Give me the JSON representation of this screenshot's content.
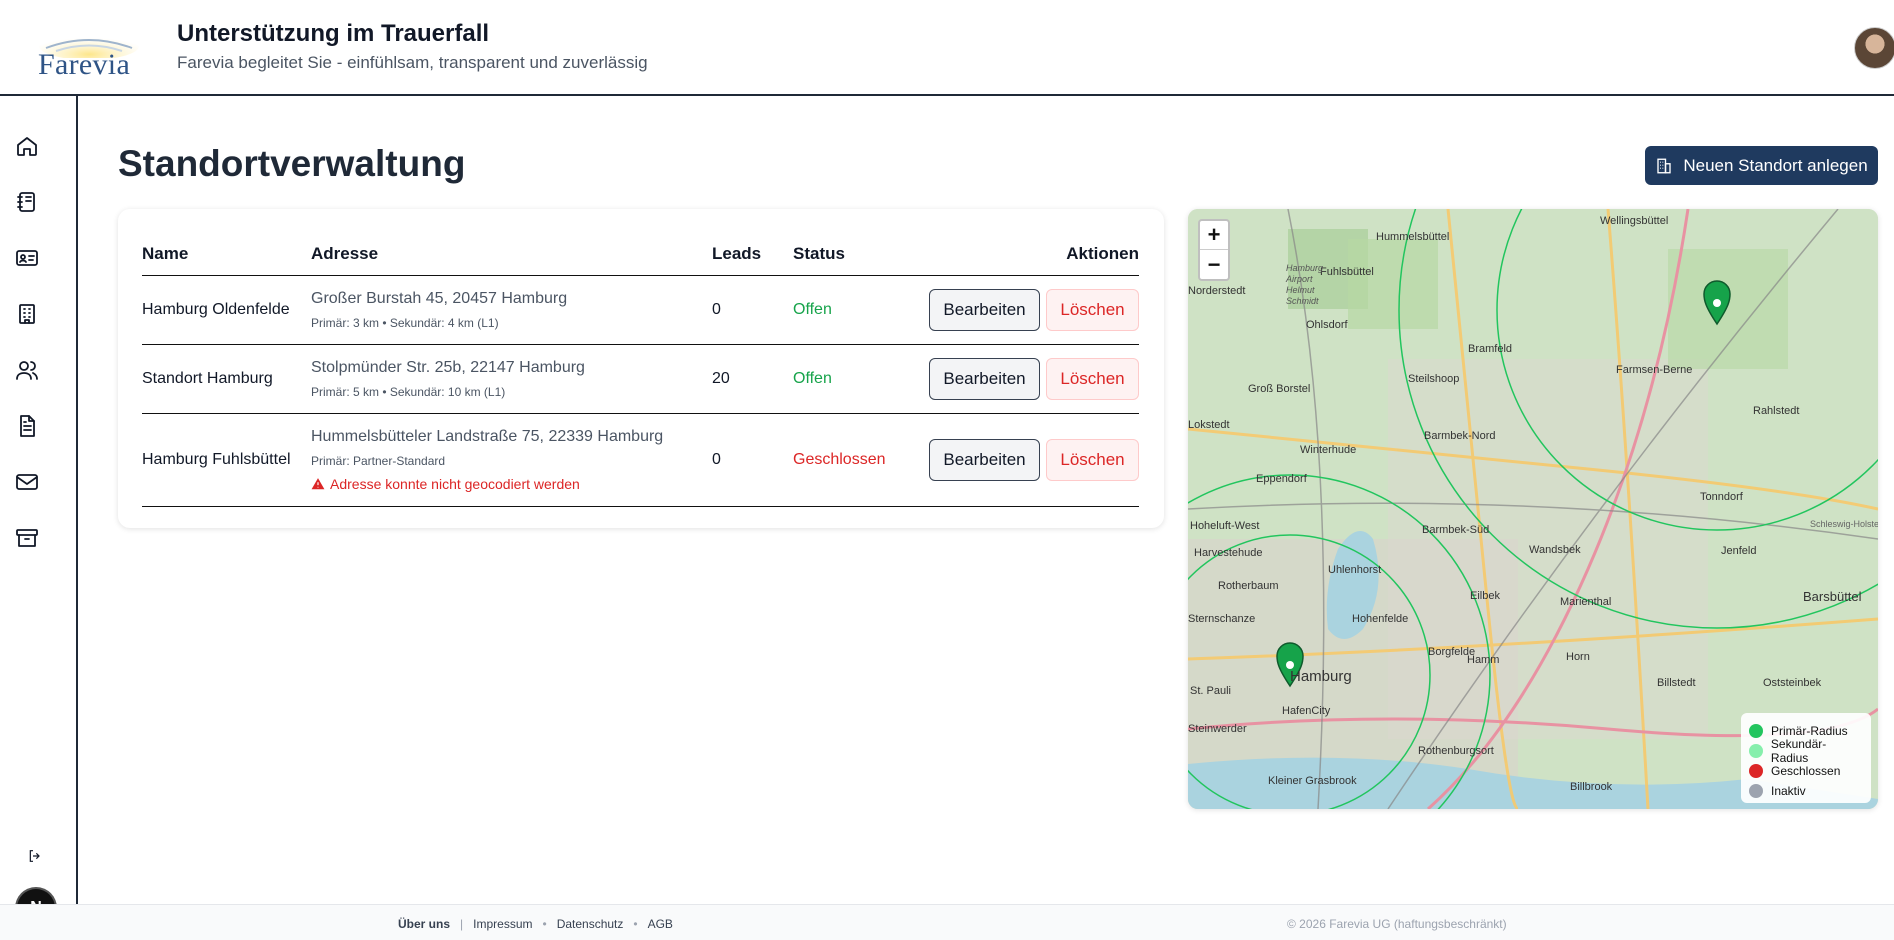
{
  "header": {
    "logo_text": "Farevia",
    "title": "Unterstützung im Trauerfall",
    "subtitle": "Farevia begleitet Sie - einfühlsam, transparent und zuverlässig"
  },
  "sidebar": {
    "items": [
      {
        "name": "home",
        "icon": "home-icon"
      },
      {
        "name": "notebook",
        "icon": "notebook-icon"
      },
      {
        "name": "contact-card",
        "icon": "id-card-icon"
      },
      {
        "name": "buildings",
        "icon": "building-icon"
      },
      {
        "name": "users",
        "icon": "users-icon"
      },
      {
        "name": "documents",
        "icon": "document-icon"
      },
      {
        "name": "mail",
        "icon": "mail-icon"
      },
      {
        "name": "archive",
        "icon": "archive-icon"
      }
    ],
    "badge": "N"
  },
  "main": {
    "title": "Standortverwaltung",
    "new_button": "Neuen Standort anlegen"
  },
  "table": {
    "headers": {
      "name": "Name",
      "address": "Adresse",
      "leads": "Leads",
      "status": "Status",
      "actions": "Aktionen"
    },
    "rows": [
      {
        "name": "Hamburg Oldenfelde",
        "address": "Großer Burstah 45, 20457 Hamburg",
        "detail": "Primär: 3 km • Sekundär: 4 km (L1)",
        "error": "",
        "leads": "0",
        "status": "Offen",
        "edit": "Bearbeiten",
        "delete": "Löschen"
      },
      {
        "name": "Standort Hamburg",
        "address": "Stolpmünder Str. 25b, 22147 Hamburg",
        "detail": "Primär: 5 km • Sekundär: 10 km (L1)",
        "error": "",
        "leads": "20",
        "status": "Offen",
        "edit": "Bearbeiten",
        "delete": "Löschen"
      },
      {
        "name": "Hamburg Fuhlsbüttel",
        "address": "Hummelsbütteler Landstraße 75, 22339 Hamburg",
        "detail": "Primär: Partner-Standard",
        "error": "Adresse konnte nicht geocodiert werden",
        "leads": "0",
        "status": "Geschlossen",
        "edit": "Bearbeiten",
        "delete": "Löschen"
      }
    ]
  },
  "map": {
    "zoom_in": "+",
    "zoom_out": "−",
    "labels": [
      "Wellingsbüttel",
      "Hummelsbüttel",
      "Fuhlsbüttel",
      "Hamburg Airport Helmut Schmidt",
      "Ohlsdorf",
      "Bramfeld",
      "Farmsen-Berne",
      "Steilshoop",
      "Groß Borstel",
      "Rahlstedt",
      "Barmbek-Nord",
      "Winterhude",
      "Eppendorf",
      "Tonndorf",
      "Hoheluft-West",
      "Barmbek-Süd",
      "Harvestehude",
      "Wandsbek",
      "Jenfeld",
      "Uhlenhorst",
      "Rotherbaum",
      "Eilbek",
      "Marienthal",
      "Barsbüttel",
      "Hohenfelde",
      "Borgfelde",
      "Hamm",
      "Horn",
      "Billstedt",
      "Oststeinbek",
      "Hamburg",
      "HafenCity",
      "Rothenburgsort",
      "Kleiner Grasbrook",
      "Billbrook",
      "Schleswig-Holstein",
      "St. Pauli",
      "Steinwerder",
      "Sternschanze",
      "Lokstedt",
      "Norderstedt"
    ],
    "legend": [
      {
        "label": "Primär-Radius",
        "color": "#22c55e"
      },
      {
        "label": "Sekundär-Radius",
        "color": "#86efac"
      },
      {
        "label": "Geschlossen",
        "color": "#dc2626"
      },
      {
        "label": "Inaktiv",
        "color": "#9ca3af"
      }
    ]
  },
  "footer": {
    "links": [
      "Über uns",
      "Impressum",
      "Datenschutz",
      "AGB"
    ],
    "copyright": "© 2026 Farevia UG (haftungsbeschränkt)"
  },
  "colors": {
    "primary": "#1f3a5f",
    "open": "#16a34a",
    "closed": "#dc2626"
  }
}
